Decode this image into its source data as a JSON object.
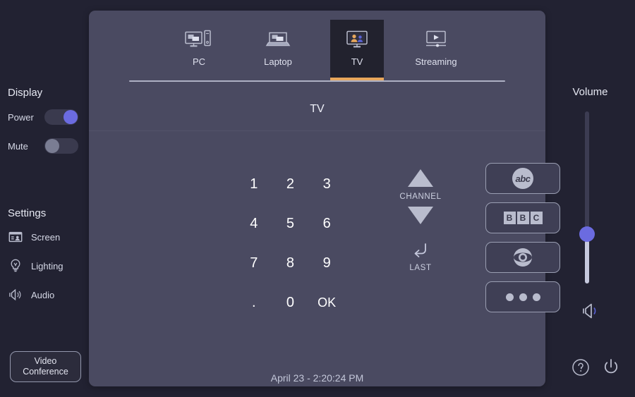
{
  "colors": {
    "app_background": "#222232",
    "panel_background": "#4a4a61",
    "active_tab_background": "#22222e",
    "accent_orange": "#e8a75c",
    "accent_purple": "#6b6be0",
    "icon_gray": "#b9bccd",
    "text_primary": "#e6e8f2"
  },
  "left_sidebar": {
    "display_heading": "Display",
    "toggles": [
      {
        "label": "Power",
        "state": "on",
        "icon": "toggle-on-icon"
      },
      {
        "label": "Mute",
        "state": "off",
        "icon": "toggle-off-icon"
      }
    ],
    "settings_heading": "Settings",
    "settings_items": [
      {
        "label": "Screen",
        "icon": "screen-icon"
      },
      {
        "label": "Lighting",
        "icon": "lightbulb-icon"
      },
      {
        "label": "Audio",
        "icon": "speaker-icon"
      }
    ],
    "video_conference_label_line1": "Video",
    "video_conference_label_line2": "Conference"
  },
  "main_panel": {
    "tabs": [
      {
        "label": "PC",
        "icon": "desktop-pc-icon",
        "active": false
      },
      {
        "label": "Laptop",
        "icon": "laptop-icon",
        "active": false
      },
      {
        "label": "TV",
        "icon": "tv-people-icon",
        "active": true
      },
      {
        "label": "Streaming",
        "icon": "video-play-icon",
        "active": false
      }
    ],
    "source_title": "TV",
    "keypad": [
      "1",
      "2",
      "3",
      "4",
      "5",
      "6",
      "7",
      "8",
      "9",
      ".",
      "0",
      "OK"
    ],
    "channel": {
      "up_icon": "triangle-up-icon",
      "label": "CHANNEL",
      "down_icon": "triangle-down-icon",
      "last_icon": "return-arrow-icon",
      "last_label": "LAST"
    },
    "presets": [
      {
        "name": "abc",
        "icon": "abc-logo-icon"
      },
      {
        "name": "BBC",
        "icon": "bbc-logo-icon",
        "letters": [
          "B",
          "B",
          "C"
        ]
      },
      {
        "name": "CBS",
        "icon": "cbs-eye-icon"
      },
      {
        "name": "More",
        "icon": "more-dots-icon"
      }
    ],
    "clock": "April 23 - 2:20:24 PM"
  },
  "right_sidebar": {
    "volume_heading": "Volume",
    "volume_icon": "speaker-wave-icon",
    "help_icon": "help-circle-icon",
    "power_icon": "power-icon"
  }
}
